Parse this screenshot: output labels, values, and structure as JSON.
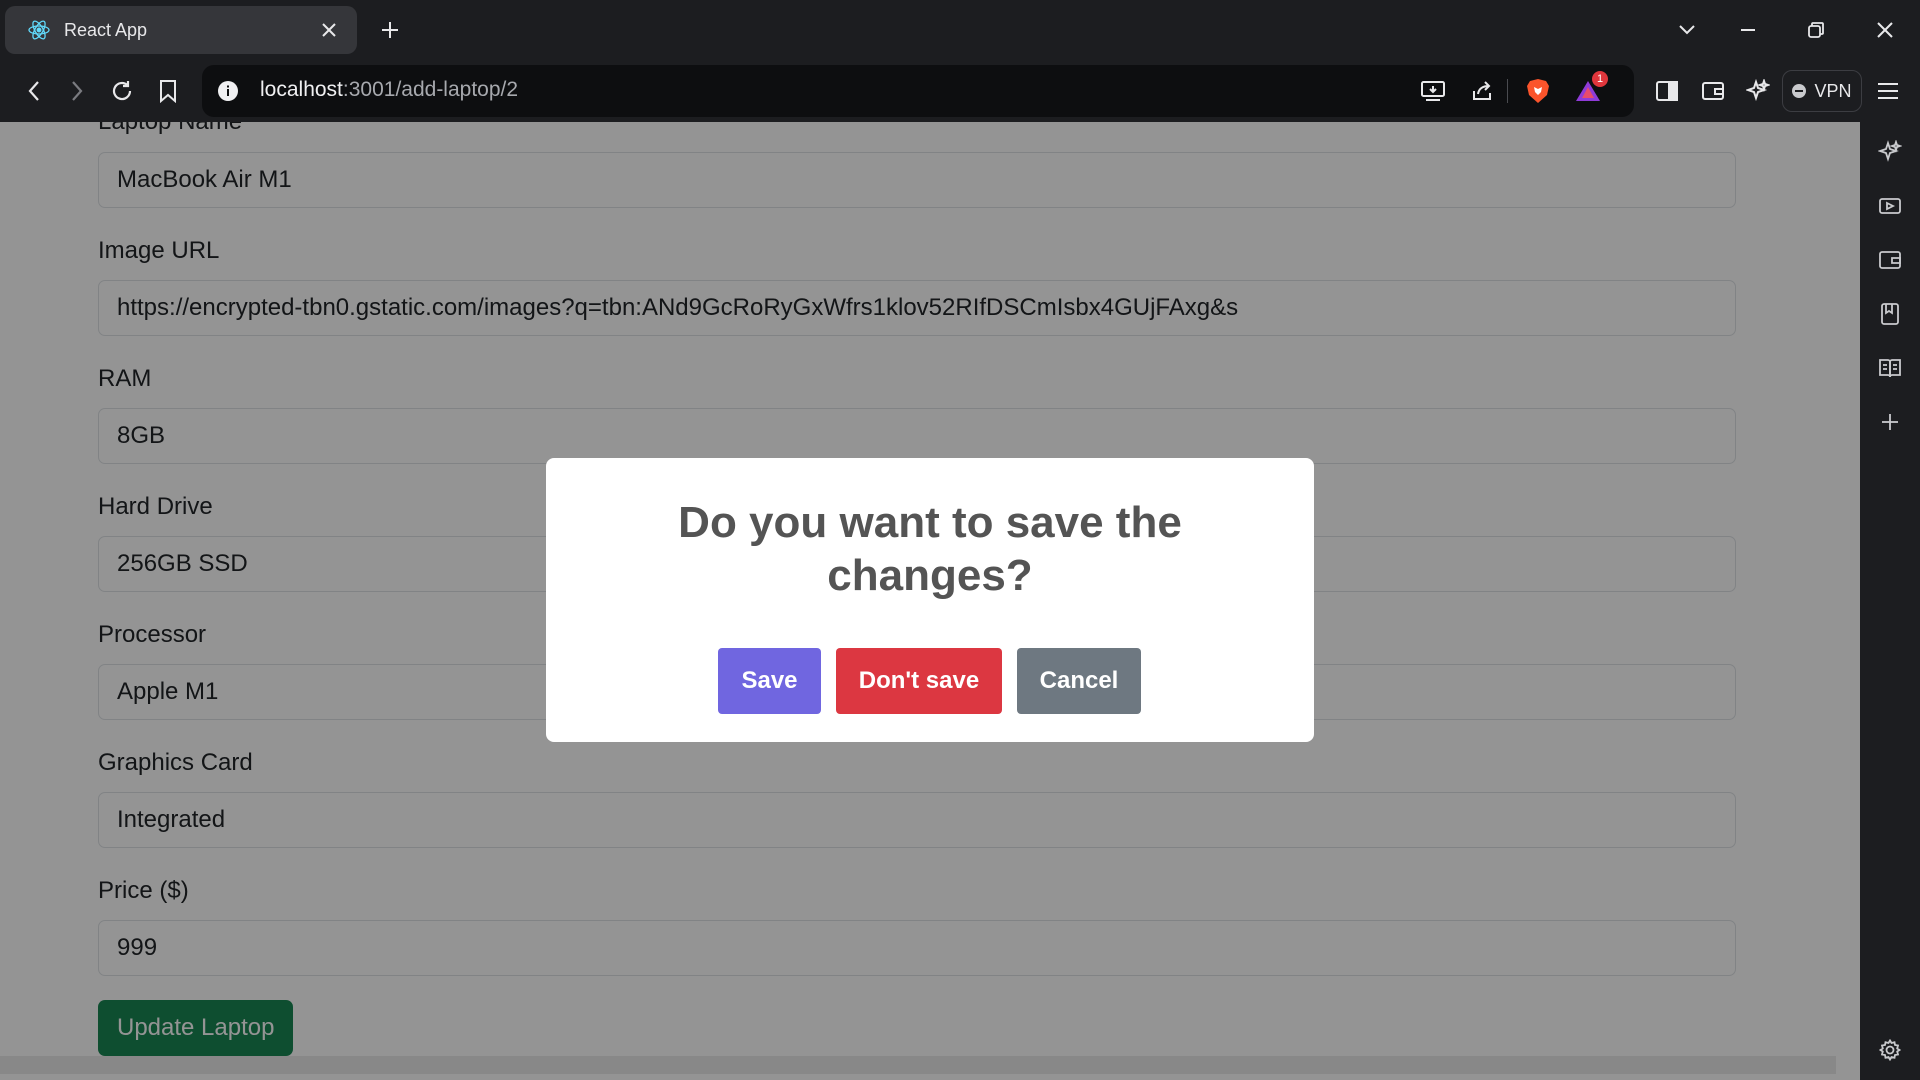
{
  "browser": {
    "tab_title": "React App",
    "url_host": "localhost",
    "url_path": ":3001/add-laptop/2",
    "notification_count": "1",
    "vpn_label": "VPN"
  },
  "form": {
    "fields": [
      {
        "label": "Laptop Name",
        "value": "MacBook Air M1"
      },
      {
        "label": "Image URL",
        "value": "https://encrypted-tbn0.gstatic.com/images?q=tbn:ANd9GcRoRyGxWfrs1klov52RIfDSCmIsbx4GUjFAxg&s"
      },
      {
        "label": "RAM",
        "value": "8GB"
      },
      {
        "label": "Hard Drive",
        "value": "256GB SSD"
      },
      {
        "label": "Processor",
        "value": "Apple M1"
      },
      {
        "label": "Graphics Card",
        "value": "Integrated"
      },
      {
        "label": "Price ($)",
        "value": "999"
      }
    ],
    "submit_label": "Update Laptop"
  },
  "dialog": {
    "title": "Do you want to save the changes?",
    "save_label": "Save",
    "dont_save_label": "Don't save",
    "cancel_label": "Cancel",
    "save_color": "#7066e0",
    "dont_save_color": "#dc3741",
    "cancel_color": "#6e7881"
  },
  "colors": {
    "success": "#198754",
    "browser_chrome": "#1c1d20"
  }
}
